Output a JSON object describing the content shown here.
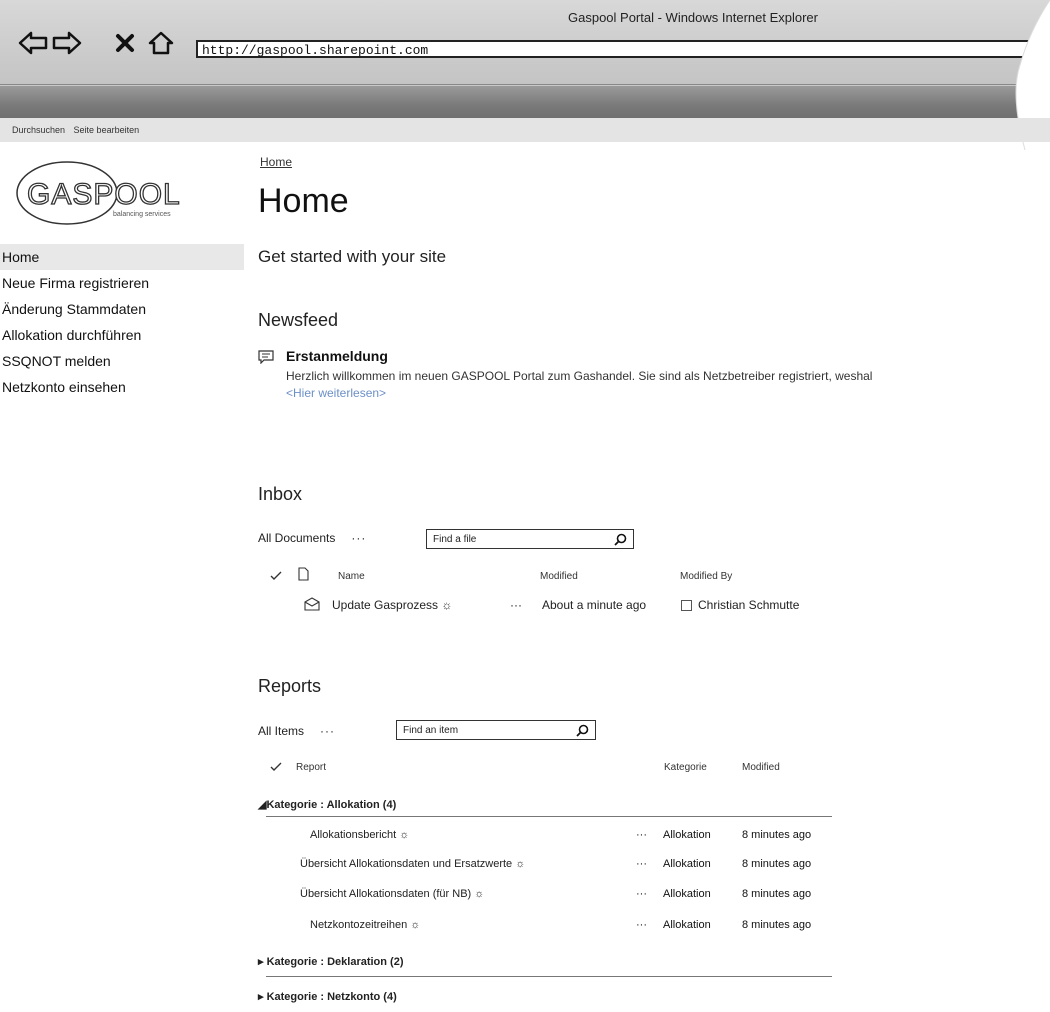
{
  "browser": {
    "window_title": "Gaspool Portal - Windows Internet Explorer",
    "address": "http://gaspool.sharepoint.com"
  },
  "ribbon": {
    "items": [
      "Durchsuchen",
      "Seite bearbeiten"
    ]
  },
  "logo": {
    "text": "GASPOOL",
    "tagline": "balancing services"
  },
  "leftnav": {
    "items": [
      "Home",
      "Neue Firma registrieren",
      "Änderung Stammdaten",
      "Allokation durchführen",
      "SSQNOT melden",
      "Netzkonto einsehen"
    ]
  },
  "main": {
    "breadcrumb": "Home",
    "title": "Home",
    "subtitle": "Get started with your site"
  },
  "newsfeed": {
    "heading": "Newsfeed",
    "post_title": "Erstanmeldung",
    "post_body": "Herzlich willkommen im neuen GASPOOL Portal zum Gashandel. Sie sind als Netzbetreiber registriert, weshal",
    "read_more": "<Hier weiterlesen>"
  },
  "inbox": {
    "heading": "Inbox",
    "view": "All Documents",
    "more": "···",
    "search_placeholder": "Find a file",
    "columns": [
      "Name",
      "Modified",
      "Modified By"
    ],
    "rows": [
      {
        "name": "Update Gasprozess ☼",
        "more": "···",
        "modified": "About a minute ago",
        "modified_by": "Christian Schmutte"
      }
    ]
  },
  "reports": {
    "heading": "Reports",
    "view": "All Items",
    "more": "···",
    "search_placeholder": "Find an item",
    "columns": [
      "Report",
      "Kategorie",
      "Modified"
    ],
    "groups": [
      {
        "label": "Kategorie : Allokation (4)",
        "expanded": true
      },
      {
        "label": "Kategorie : Deklaration (2)",
        "expanded": false
      },
      {
        "label": "Kategorie : Netzkonto (4)",
        "expanded": false
      }
    ],
    "rows": [
      {
        "name": "Allokationsbericht ☼",
        "more": "···",
        "kategorie": "Allokation",
        "modified": "8 minutes ago"
      },
      {
        "name": "Übersicht Allokationsdaten und Ersatzwerte ☼",
        "more": "···",
        "kategorie": "Allokation",
        "modified": "8 minutes ago"
      },
      {
        "name": "Übersicht Allokationsdaten (für NB) ☼",
        "more": "···",
        "kategorie": "Allokation",
        "modified": "8 minutes ago"
      },
      {
        "name": "Netzkontozeitreihen ☼",
        "more": "···",
        "kategorie": "Allokation",
        "modified": "8 minutes ago"
      }
    ]
  }
}
